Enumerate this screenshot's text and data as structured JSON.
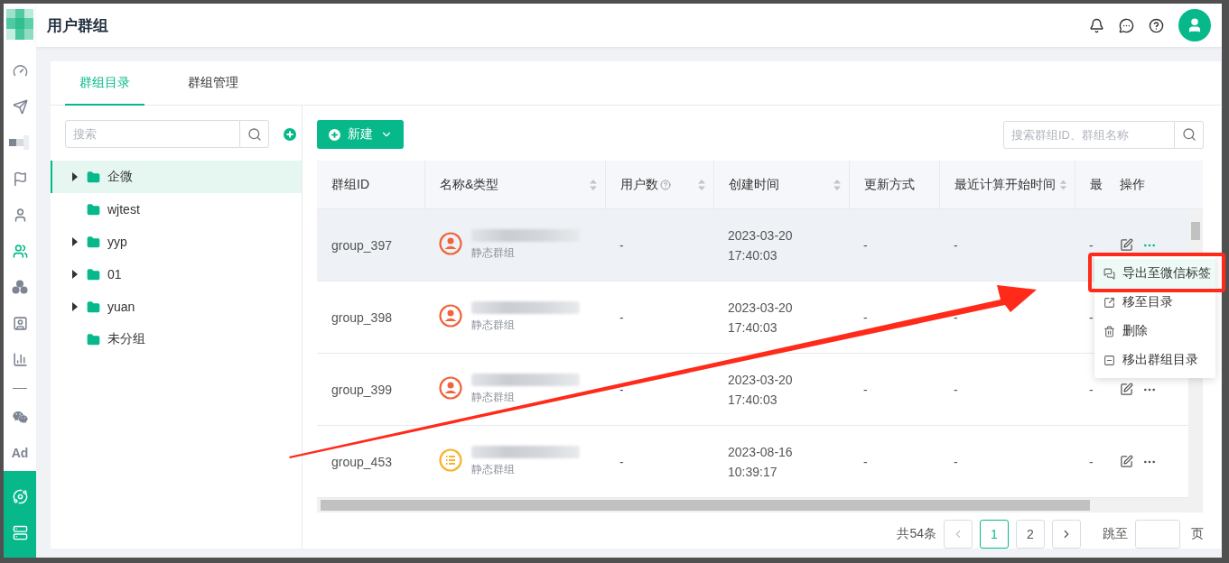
{
  "sidebar": {
    "items": [
      {
        "kind": "gauge",
        "selected": false
      },
      {
        "kind": "send",
        "selected": false
      },
      {
        "kind": "mosaic",
        "selected": false
      },
      {
        "kind": "flag",
        "selected": false
      },
      {
        "kind": "user",
        "selected": false
      },
      {
        "kind": "users",
        "selected": true
      },
      {
        "kind": "cluster",
        "selected": false
      },
      {
        "kind": "contact",
        "selected": false
      },
      {
        "kind": "bars",
        "selected": false
      },
      {
        "kind": "divider",
        "selected": false
      },
      {
        "kind": "wechat",
        "selected": false
      },
      {
        "kind": "text",
        "label": "Ad",
        "selected": false
      }
    ],
    "pinned": [
      {
        "kind": "orbit"
      },
      {
        "kind": "server"
      }
    ]
  },
  "header": {
    "title": "用户群组"
  },
  "tabs": [
    {
      "label": "群组目录",
      "selected": true
    },
    {
      "label": "群组管理",
      "selected": false
    }
  ],
  "tree": {
    "search": {
      "placeholder": "搜索"
    },
    "items": [
      {
        "label": "企微",
        "expandable": true,
        "expanded": false,
        "selected": true
      },
      {
        "label": "wjtest",
        "expandable": false,
        "expanded": false,
        "selected": false
      },
      {
        "label": "yyp",
        "expandable": true,
        "expanded": false,
        "selected": false
      },
      {
        "label": "01",
        "expandable": true,
        "expanded": false,
        "selected": false
      },
      {
        "label": "yuan",
        "expandable": true,
        "expanded": false,
        "selected": false
      },
      {
        "label": "未分组",
        "expandable": false,
        "expanded": false,
        "selected": false
      }
    ]
  },
  "toolbar": {
    "new_button": "新建",
    "search": {
      "placeholder": "搜索群组ID、群组名称"
    }
  },
  "table": {
    "columns": [
      {
        "label": "群组ID",
        "sortable": false,
        "help": false
      },
      {
        "label": "名称&类型",
        "sortable": true,
        "help": false
      },
      {
        "label": "用户数",
        "sortable": true,
        "help": true
      },
      {
        "label": "创建时间",
        "sortable": true,
        "help": false
      },
      {
        "label": "更新方式",
        "sortable": false,
        "help": false
      },
      {
        "label": "最近计算开始时间",
        "sortable": true,
        "help": false
      },
      {
        "label": "最"
      },
      {
        "label": "操作",
        "sortable": false,
        "help": false
      }
    ],
    "rows": [
      {
        "id": "group_397",
        "kind": "person",
        "type": "静态群组",
        "users": "-",
        "date": "2023-03-20",
        "time": "17:40:03",
        "update": "-",
        "calc": "-",
        "column_7": "-",
        "highlighted": true,
        "menu_open": true
      },
      {
        "id": "group_398",
        "kind": "person",
        "type": "静态群组",
        "users": "-",
        "date": "2023-03-20",
        "time": "17:40:03",
        "update": "-",
        "calc": "-",
        "column_7": "-",
        "highlighted": false,
        "menu_open": false
      },
      {
        "id": "group_399",
        "kind": "person",
        "type": "静态群组",
        "users": "-",
        "date": "2023-03-20",
        "time": "17:40:03",
        "update": "-",
        "calc": "-",
        "column_7": "-",
        "highlighted": false,
        "menu_open": false
      },
      {
        "id": "group_453",
        "kind": "list",
        "type": "静态群组",
        "users": "-",
        "date": "2023-08-16",
        "time": "10:39:17",
        "update": "-",
        "calc": "-",
        "column_7": "-",
        "highlighted": false,
        "menu_open": false
      }
    ],
    "menu": {
      "items": [
        {
          "label": "导出至微信标签",
          "kind": "wechat",
          "highlighted": true
        },
        {
          "label": "移至目录",
          "kind": "move",
          "highlighted": false
        },
        {
          "label": "删除",
          "kind": "delete",
          "highlighted": false
        },
        {
          "label": "移出群组目录",
          "kind": "remove",
          "highlighted": false
        }
      ]
    }
  },
  "pagination": {
    "total": "共54条",
    "pages": [
      {
        "label": "1",
        "selected": true
      },
      {
        "label": "2",
        "selected": false
      }
    ],
    "prev_disabled": true,
    "jump_label": "跳至",
    "page_suffix": "页"
  }
}
